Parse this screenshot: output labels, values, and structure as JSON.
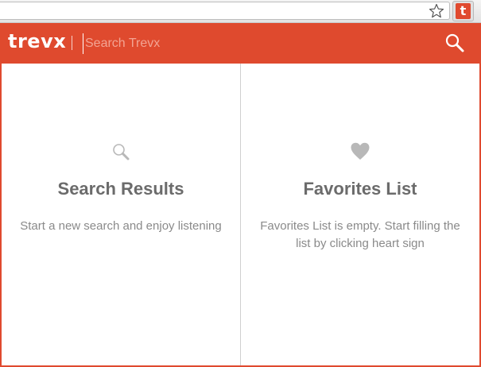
{
  "browser": {
    "star_icon": "star-icon",
    "extension_letter": "t"
  },
  "header": {
    "logo": "trevx",
    "search_placeholder": "Search Trevx",
    "search_icon": "search-icon"
  },
  "panels": [
    {
      "icon": "magnifier-icon",
      "title": "Search Results",
      "text": "Start a new search and enjoy listening"
    },
    {
      "icon": "heart-icon",
      "title": "Favorites List",
      "text": "Favorites List is empty. Start filling the list by clicking heart sign"
    }
  ],
  "colors": {
    "brand": "#df4a2e",
    "title_text": "#6b6b6b",
    "body_text": "#8a8a8a"
  }
}
